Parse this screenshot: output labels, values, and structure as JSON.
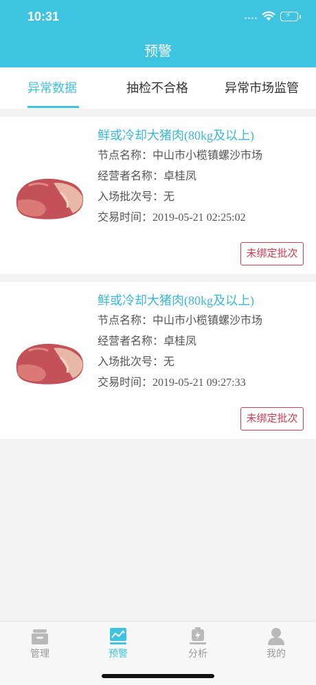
{
  "status_bar": {
    "time": "10:31"
  },
  "header": {
    "title": "预警"
  },
  "tabs": [
    {
      "label": "异常数据",
      "active": true
    },
    {
      "label": "抽检不合格",
      "active": false
    },
    {
      "label": "异常市场监管",
      "active": false
    }
  ],
  "records": [
    {
      "product": "鲜或冷却大猪肉(80kg及以上)",
      "node_label": "节点名称：",
      "node_value": "中山市小榄镇螺沙市场",
      "operator_label": "经营者名称：",
      "operator_value": "卓桂凤",
      "batch_label": "入场批次号：",
      "batch_value": "无",
      "time_label": "交易时间：",
      "time_value": "2019-05-21 02:25:02",
      "badge": "未绑定批次"
    },
    {
      "product": "鲜或冷却大猪肉(80kg及以上)",
      "node_label": "节点名称：",
      "node_value": "中山市小榄镇螺沙市场",
      "operator_label": "经营者名称：",
      "operator_value": "卓桂凤",
      "batch_label": "入场批次号：",
      "batch_value": "无",
      "time_label": "交易时间：",
      "time_value": "2019-05-21 09:27:33",
      "badge": "未绑定批次"
    }
  ],
  "tabbar": [
    {
      "label": "管理",
      "icon": "box-icon"
    },
    {
      "label": "预警",
      "icon": "chart-icon",
      "active": true
    },
    {
      "label": "分析",
      "icon": "battery-bolt-icon"
    },
    {
      "label": "我的",
      "icon": "user-icon"
    }
  ],
  "colors": {
    "accent": "#3ec3e0",
    "badge": "#d8394e",
    "inactive": "#9a9a9a"
  }
}
